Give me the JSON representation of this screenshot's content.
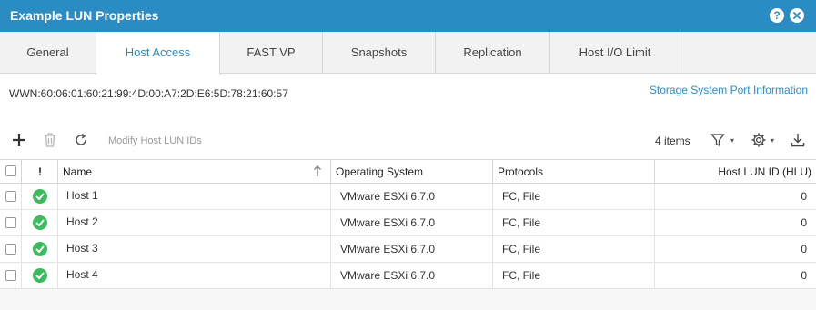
{
  "window": {
    "title": "Example LUN Properties",
    "help_label": "?",
    "accent_color": "#2b8cc4"
  },
  "tabs": [
    {
      "label": "General",
      "active": false
    },
    {
      "label": "Host Access",
      "active": true
    },
    {
      "label": "FAST VP",
      "active": false
    },
    {
      "label": "Snapshots",
      "active": false
    },
    {
      "label": "Replication",
      "active": false
    },
    {
      "label": "Host I/O Limit",
      "active": false
    }
  ],
  "wwn": "WWN:60:06:01:60:21:99:4D:00:A7:2D:E6:5D:78:21:60:57",
  "port_link": "Storage System Port Information",
  "toolbar": {
    "add_icon": "plus-icon",
    "delete_icon": "trash-icon",
    "refresh_icon": "refresh-icon",
    "modify_label": "Modify Host LUN IDs",
    "item_count": "4 items",
    "filter_icon": "filter-icon",
    "settings_icon": "gear-icon",
    "export_icon": "download-icon"
  },
  "table": {
    "columns": [
      "!",
      "Name",
      "Operating System",
      "Protocols",
      "Host LUN ID (HLU)"
    ],
    "sorted_column": "Name",
    "sort_direction": "ascending",
    "rows": [
      {
        "status": "ok",
        "name": "Host 1",
        "os": "VMware ESXi 6.7.0",
        "protocols": "FC, File",
        "hlu": "0"
      },
      {
        "status": "ok",
        "name": "Host 2",
        "os": "VMware ESXi 6.7.0",
        "protocols": "FC, File",
        "hlu": "0"
      },
      {
        "status": "ok",
        "name": "Host 3",
        "os": "VMware ESXi 6.7.0",
        "protocols": "FC, File",
        "hlu": "0"
      },
      {
        "status": "ok",
        "name": "Host 4",
        "os": "VMware ESXi 6.7.0",
        "protocols": "FC, File",
        "hlu": "0"
      }
    ]
  }
}
